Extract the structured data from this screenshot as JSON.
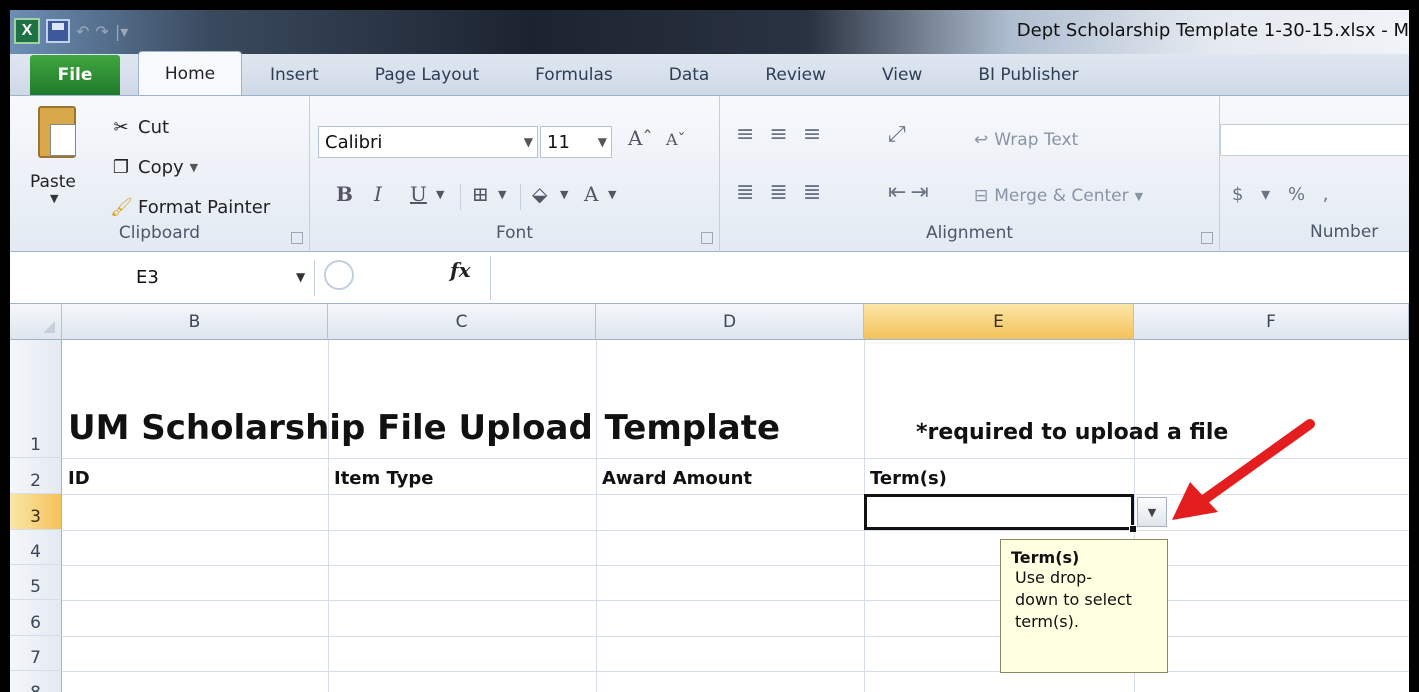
{
  "window": {
    "title": "Dept Scholarship Template 1-30-15.xlsx - M",
    "app_icon": "excel-icon"
  },
  "ribbon_tabs": [
    "File",
    "Home",
    "Insert",
    "Page Layout",
    "Formulas",
    "Data",
    "Review",
    "View",
    "BI Publisher"
  ],
  "clipboard": {
    "paste": "Paste",
    "cut": "Cut",
    "copy": "Copy",
    "format_painter": "Format Painter",
    "label": "Clipboard"
  },
  "font": {
    "name": "Calibri",
    "size": "11",
    "label": "Font"
  },
  "alignment": {
    "wrap_text": "Wrap Text",
    "merge_center": "Merge & Center",
    "label": "Alignment"
  },
  "number": {
    "label": "Number",
    "currency": "$",
    "percent": "%",
    "comma": ","
  },
  "formula_bar": {
    "name_box": "E3",
    "fx": "fx",
    "value": ""
  },
  "grid": {
    "columns": [
      "B",
      "C",
      "D",
      "E",
      "F"
    ],
    "selected_column": "E",
    "rows": [
      "1",
      "2",
      "3",
      "4",
      "5",
      "6",
      "7",
      "8"
    ],
    "selected_row": "3",
    "title": "UM Scholarship File Upload Template",
    "required_note": "*required to upload a file",
    "headers": [
      "ID",
      "Item Type",
      "Award Amount",
      "Term(s)"
    ]
  },
  "tooltip": {
    "title": "Term(s)",
    "lines": [
      "Use drop-",
      "down to select",
      "term(s)."
    ]
  },
  "colors": {
    "accent_arrow": "#e41e1e",
    "selected_header": "#f5c15a",
    "tooltip_bg": "#ffffe1"
  }
}
